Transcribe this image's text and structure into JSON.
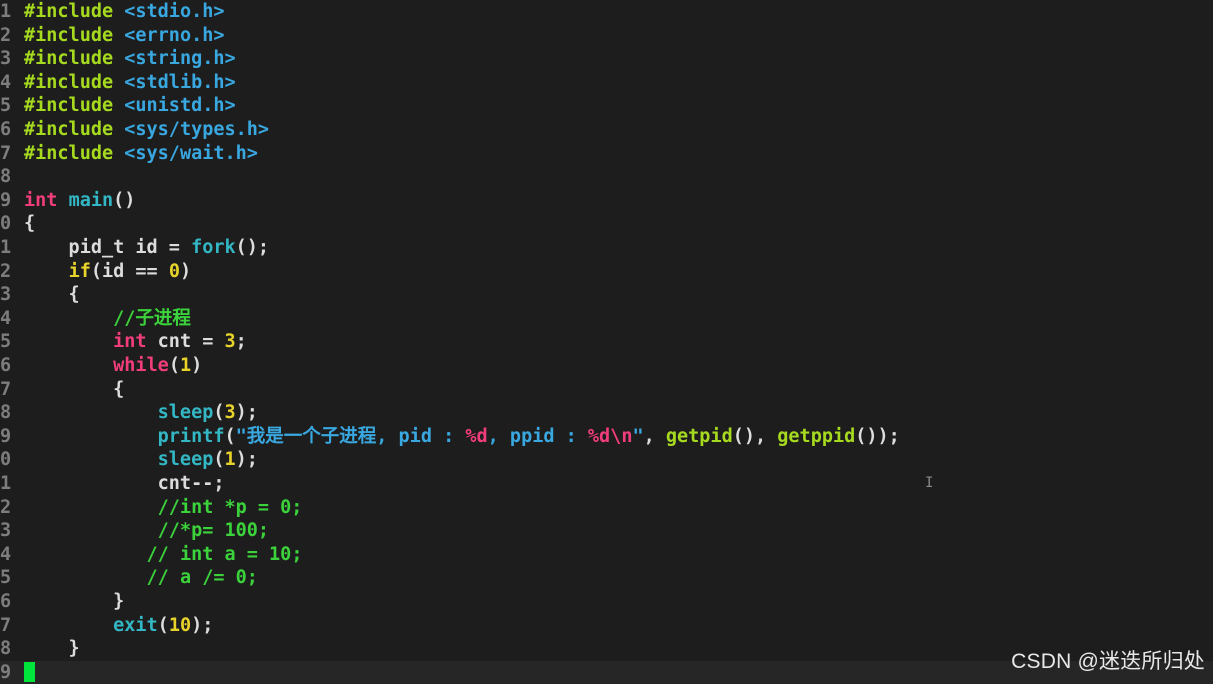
{
  "editor": {
    "lines": [
      {
        "n": "1",
        "tokens": [
          {
            "t": "#include",
            "c": "#a6da1f"
          },
          {
            "t": " ",
            "c": "#dcdcdc"
          },
          {
            "t": "<stdio.h>",
            "c": "#39a8e0"
          }
        ]
      },
      {
        "n": "2",
        "tokens": [
          {
            "t": "#include",
            "c": "#a6da1f"
          },
          {
            "t": " ",
            "c": "#dcdcdc"
          },
          {
            "t": "<errno.h>",
            "c": "#39a8e0"
          }
        ]
      },
      {
        "n": "3",
        "tokens": [
          {
            "t": "#include",
            "c": "#a6da1f"
          },
          {
            "t": " ",
            "c": "#dcdcdc"
          },
          {
            "t": "<string.h>",
            "c": "#39a8e0"
          }
        ]
      },
      {
        "n": "4",
        "tokens": [
          {
            "t": "#include",
            "c": "#a6da1f"
          },
          {
            "t": " ",
            "c": "#dcdcdc"
          },
          {
            "t": "<stdlib.h>",
            "c": "#39a8e0"
          }
        ]
      },
      {
        "n": "5",
        "tokens": [
          {
            "t": "#include",
            "c": "#a6da1f"
          },
          {
            "t": " ",
            "c": "#dcdcdc"
          },
          {
            "t": "<unistd.h>",
            "c": "#39a8e0"
          }
        ]
      },
      {
        "n": "6",
        "tokens": [
          {
            "t": "#include",
            "c": "#a6da1f"
          },
          {
            "t": " ",
            "c": "#dcdcdc"
          },
          {
            "t": "<sys/types.h>",
            "c": "#39a8e0"
          }
        ]
      },
      {
        "n": "7",
        "tokens": [
          {
            "t": "#include",
            "c": "#a6da1f"
          },
          {
            "t": " ",
            "c": "#dcdcdc"
          },
          {
            "t": "<sys/wait.h>",
            "c": "#39a8e0"
          }
        ]
      },
      {
        "n": "8",
        "tokens": []
      },
      {
        "n": "9",
        "tokens": [
          {
            "t": "int",
            "c": "#f23d7c"
          },
          {
            "t": " ",
            "c": "#dcdcdc"
          },
          {
            "t": "main",
            "c": "#33b7c4"
          },
          {
            "t": "()",
            "c": "#dcdcdc"
          }
        ]
      },
      {
        "n": "0",
        "tokens": [
          {
            "t": "{",
            "c": "#dcdcdc"
          }
        ]
      },
      {
        "n": "1",
        "tokens": [
          {
            "t": "    pid_t id = ",
            "c": "#dcdcdc"
          },
          {
            "t": "fork",
            "c": "#33b7c4"
          },
          {
            "t": "();",
            "c": "#dcdcdc"
          }
        ]
      },
      {
        "n": "2",
        "tokens": [
          {
            "t": "    ",
            "c": "#dcdcdc"
          },
          {
            "t": "if",
            "c": "#e8d32a"
          },
          {
            "t": "(id == ",
            "c": "#dcdcdc"
          },
          {
            "t": "0",
            "c": "#e8d32a"
          },
          {
            "t": ")",
            "c": "#dcdcdc"
          }
        ]
      },
      {
        "n": "3",
        "tokens": [
          {
            "t": "    {",
            "c": "#dcdcdc"
          }
        ]
      },
      {
        "n": "4",
        "tokens": [
          {
            "t": "        ",
            "c": "#dcdcdc"
          },
          {
            "t": "//子进程",
            "c": "#3bd23b"
          }
        ]
      },
      {
        "n": "5",
        "tokens": [
          {
            "t": "        ",
            "c": "#dcdcdc"
          },
          {
            "t": "int",
            "c": "#f23d7c"
          },
          {
            "t": " cnt = ",
            "c": "#dcdcdc"
          },
          {
            "t": "3",
            "c": "#e8d32a"
          },
          {
            "t": ";",
            "c": "#dcdcdc"
          }
        ]
      },
      {
        "n": "6",
        "tokens": [
          {
            "t": "        ",
            "c": "#dcdcdc"
          },
          {
            "t": "while",
            "c": "#f23d7c"
          },
          {
            "t": "(",
            "c": "#dcdcdc"
          },
          {
            "t": "1",
            "c": "#e8d32a"
          },
          {
            "t": ")",
            "c": "#dcdcdc"
          }
        ]
      },
      {
        "n": "7",
        "tokens": [
          {
            "t": "        {",
            "c": "#dcdcdc"
          }
        ]
      },
      {
        "n": "8",
        "tokens": [
          {
            "t": "            ",
            "c": "#dcdcdc"
          },
          {
            "t": "sleep",
            "c": "#33b7c4"
          },
          {
            "t": "(",
            "c": "#dcdcdc"
          },
          {
            "t": "3",
            "c": "#e8d32a"
          },
          {
            "t": ");",
            "c": "#dcdcdc"
          }
        ]
      },
      {
        "n": "9",
        "tokens": [
          {
            "t": "            ",
            "c": "#dcdcdc"
          },
          {
            "t": "printf",
            "c": "#33b7c4"
          },
          {
            "t": "(",
            "c": "#dcdcdc"
          },
          {
            "t": "\"我是一个子进程, pid : ",
            "c": "#39a8e0"
          },
          {
            "t": "%d",
            "c": "#f23d7c"
          },
          {
            "t": ", ppid : ",
            "c": "#39a8e0"
          },
          {
            "t": "%d\\n",
            "c": "#f23d7c"
          },
          {
            "t": "\"",
            "c": "#39a8e0"
          },
          {
            "t": ", ",
            "c": "#dcdcdc"
          },
          {
            "t": "getpid",
            "c": "#a6da1f"
          },
          {
            "t": "(), ",
            "c": "#dcdcdc"
          },
          {
            "t": "getppid",
            "c": "#a6da1f"
          },
          {
            "t": "());",
            "c": "#dcdcdc"
          }
        ]
      },
      {
        "n": "0",
        "tokens": [
          {
            "t": "            ",
            "c": "#dcdcdc"
          },
          {
            "t": "sleep",
            "c": "#33b7c4"
          },
          {
            "t": "(",
            "c": "#dcdcdc"
          },
          {
            "t": "1",
            "c": "#e8d32a"
          },
          {
            "t": ");",
            "c": "#dcdcdc"
          }
        ]
      },
      {
        "n": "1",
        "tokens": [
          {
            "t": "            cnt--;",
            "c": "#dcdcdc"
          }
        ]
      },
      {
        "n": "2",
        "tokens": [
          {
            "t": "            ",
            "c": "#dcdcdc"
          },
          {
            "t": "//int *p = 0;",
            "c": "#3bd23b"
          }
        ]
      },
      {
        "n": "3",
        "tokens": [
          {
            "t": "            ",
            "c": "#dcdcdc"
          },
          {
            "t": "//*p= 100;",
            "c": "#3bd23b"
          }
        ]
      },
      {
        "n": "4",
        "tokens": [
          {
            "t": "           ",
            "c": "#dcdcdc"
          },
          {
            "t": "// int a = 10;",
            "c": "#3bd23b"
          }
        ]
      },
      {
        "n": "5",
        "tokens": [
          {
            "t": "           ",
            "c": "#dcdcdc"
          },
          {
            "t": "// a /= 0;",
            "c": "#3bd23b"
          }
        ]
      },
      {
        "n": "6",
        "tokens": [
          {
            "t": "        }",
            "c": "#dcdcdc"
          }
        ]
      },
      {
        "n": "7",
        "tokens": [
          {
            "t": "        ",
            "c": "#dcdcdc"
          },
          {
            "t": "exit",
            "c": "#33b7c4"
          },
          {
            "t": "(",
            "c": "#dcdcdc"
          },
          {
            "t": "10",
            "c": "#e8d32a"
          },
          {
            "t": ");",
            "c": "#dcdcdc"
          }
        ]
      },
      {
        "n": "8",
        "tokens": [
          {
            "t": "    }",
            "c": "#dcdcdc"
          }
        ]
      },
      {
        "n": "9",
        "tokens": [],
        "cursor": true
      }
    ]
  },
  "watermark": "CSDN @迷迭所归处"
}
